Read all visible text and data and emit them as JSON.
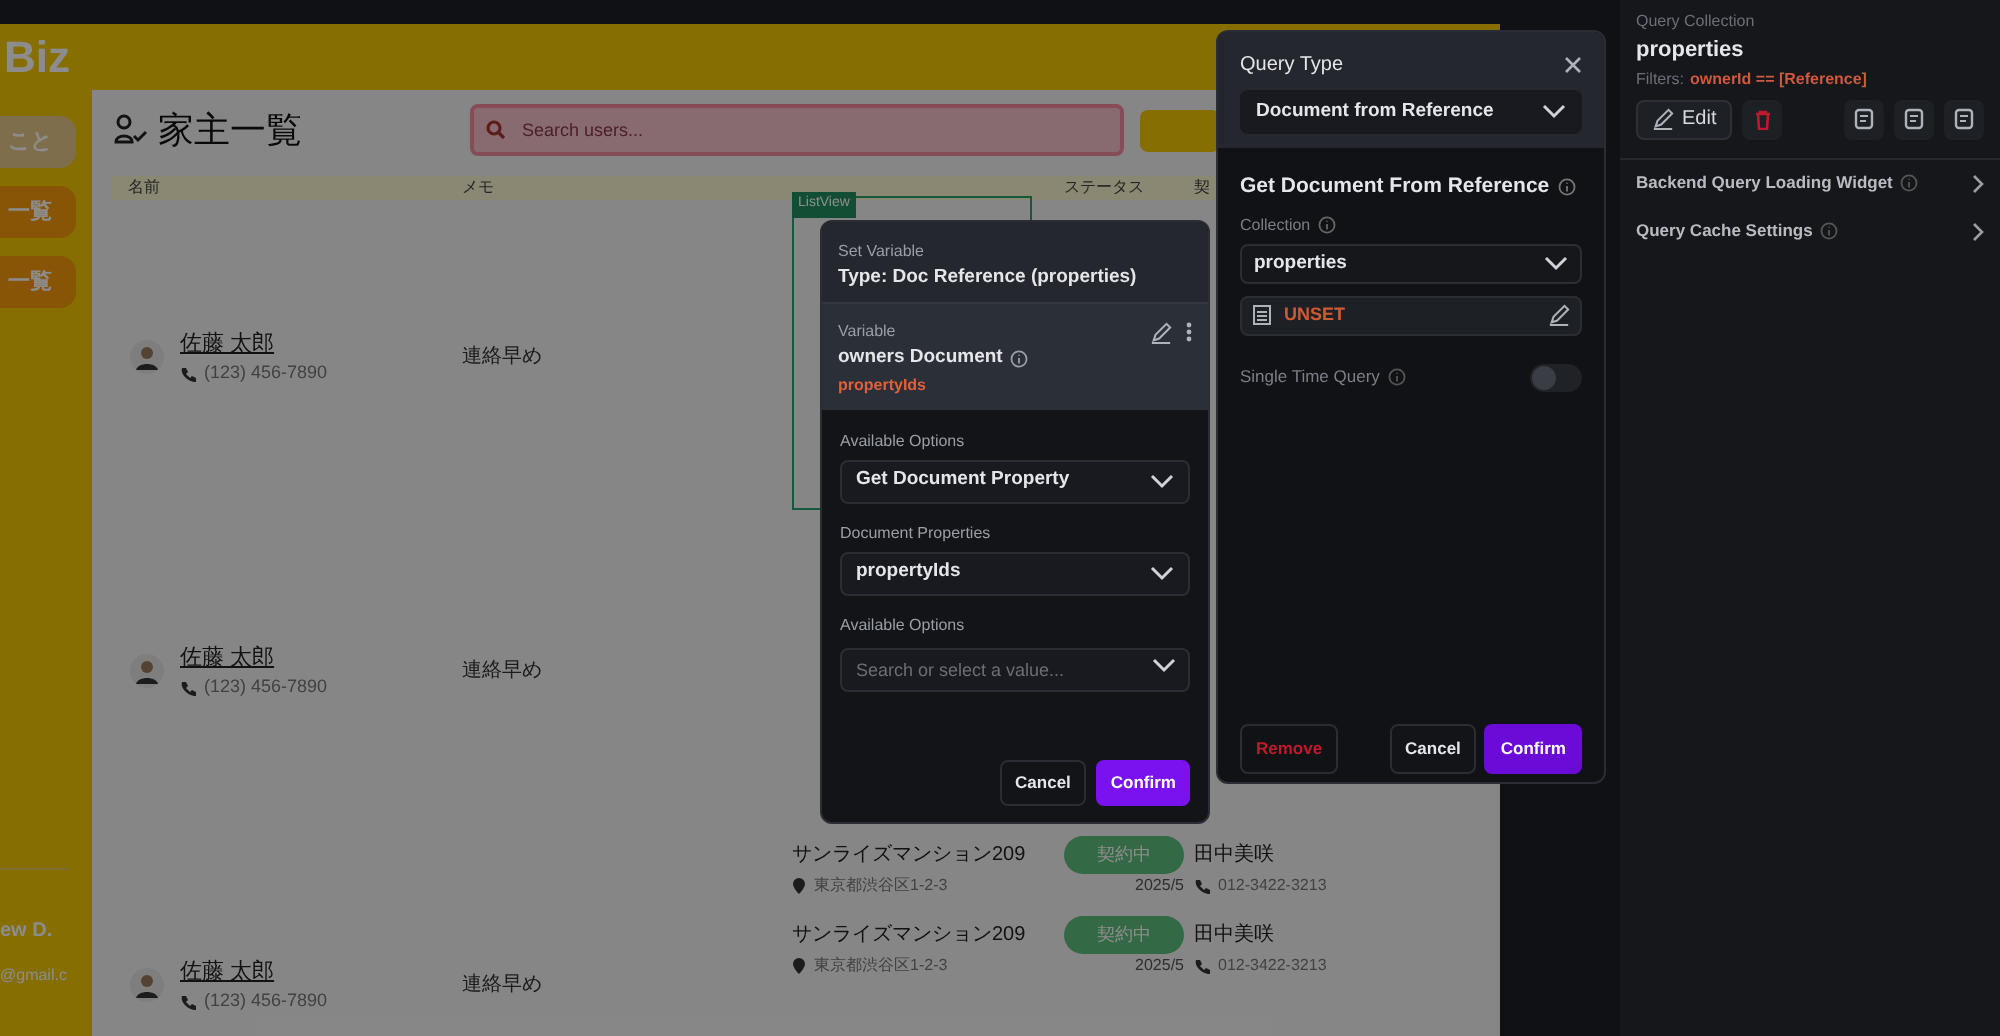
{
  "app": {
    "brand": "Biz",
    "nav": [
      {
        "label": "こと",
        "selected": true
      },
      {
        "label": "一覧",
        "selected": false
      },
      {
        "label": "一覧",
        "selected": false
      }
    ],
    "user": {
      "name": "ew D.",
      "email": "@gmail.c"
    },
    "page_title": "家主一覧",
    "search": {
      "placeholder": "Search users..."
    },
    "columns": [
      "名前",
      "メモ",
      "ステータス",
      "契"
    ],
    "listview_tag": "ListView",
    "owners": [
      {
        "name": "佐藤 太郎",
        "phone": "(123) 456-7890",
        "memo": "連絡早め"
      },
      {
        "name": "佐藤 太郎",
        "phone": "(123) 456-7890",
        "memo": "連絡早め"
      },
      {
        "name": "佐藤 太郎",
        "phone": "(123) 456-7890",
        "memo": "連絡早め"
      }
    ],
    "properties": [
      {
        "name": "サンライズマンション209",
        "address": "東京都渋谷区1-2-3",
        "status": "契約中",
        "date": "2025/5",
        "contact": "田中美咲",
        "phone": "012-3422-3213"
      },
      {
        "name": "サンライズマンション209",
        "address": "東京都渋谷区1-2-3",
        "status": "契約中",
        "date": "2025/5",
        "contact": "田中美咲",
        "phone": "012-3422-3213"
      }
    ]
  },
  "set_variable_dialog": {
    "heading": "Set Variable",
    "type": "Type: Doc Reference (properties)",
    "variable_label": "Variable",
    "variable_name": "owners Document",
    "variable_field": "propertyIds",
    "fields": [
      {
        "label": "Available Options",
        "value": "Get Document Property"
      },
      {
        "label": "Document Properties",
        "value": "propertyIds"
      },
      {
        "label": "Available Options",
        "placeholder": "Search or select a value..."
      }
    ],
    "buttons": {
      "cancel": "Cancel",
      "confirm": "Confirm"
    }
  },
  "query_dialog": {
    "title": "Query Type",
    "query_type": "Document from Reference",
    "section": "Get Document From Reference",
    "collection_label": "Collection",
    "collection": "properties",
    "reference": "UNSET",
    "single_time_query": {
      "label": "Single Time Query",
      "on": false
    },
    "buttons": {
      "remove": "Remove",
      "cancel": "Cancel",
      "confirm": "Confirm"
    }
  },
  "inspector": {
    "label": "Query Collection",
    "collection": "properties",
    "filters_label": "Filters:",
    "filters": "ownerId == [Reference]",
    "edit": "Edit",
    "sections": [
      "Backend Query Loading Widget",
      "Query Cache Settings"
    ]
  }
}
